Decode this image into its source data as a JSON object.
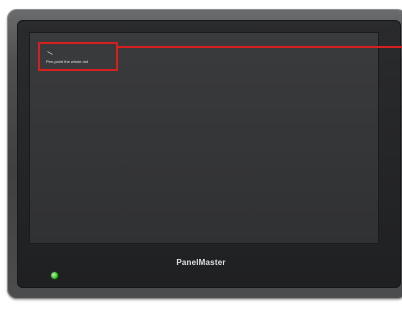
{
  "device": {
    "brand_label": "PanelMaster"
  },
  "screen": {
    "instruction_text": "Pen-point the whole dot"
  },
  "colors": {
    "bezel": "#4a4c4e",
    "screen": "#353638",
    "callout": "#d62020",
    "status_led": "#3fbf2f",
    "brand_text": "#dfe1e3"
  },
  "icons": {
    "calibration_marker": "pen-mark-icon",
    "status_indicator": "power-led-icon"
  }
}
